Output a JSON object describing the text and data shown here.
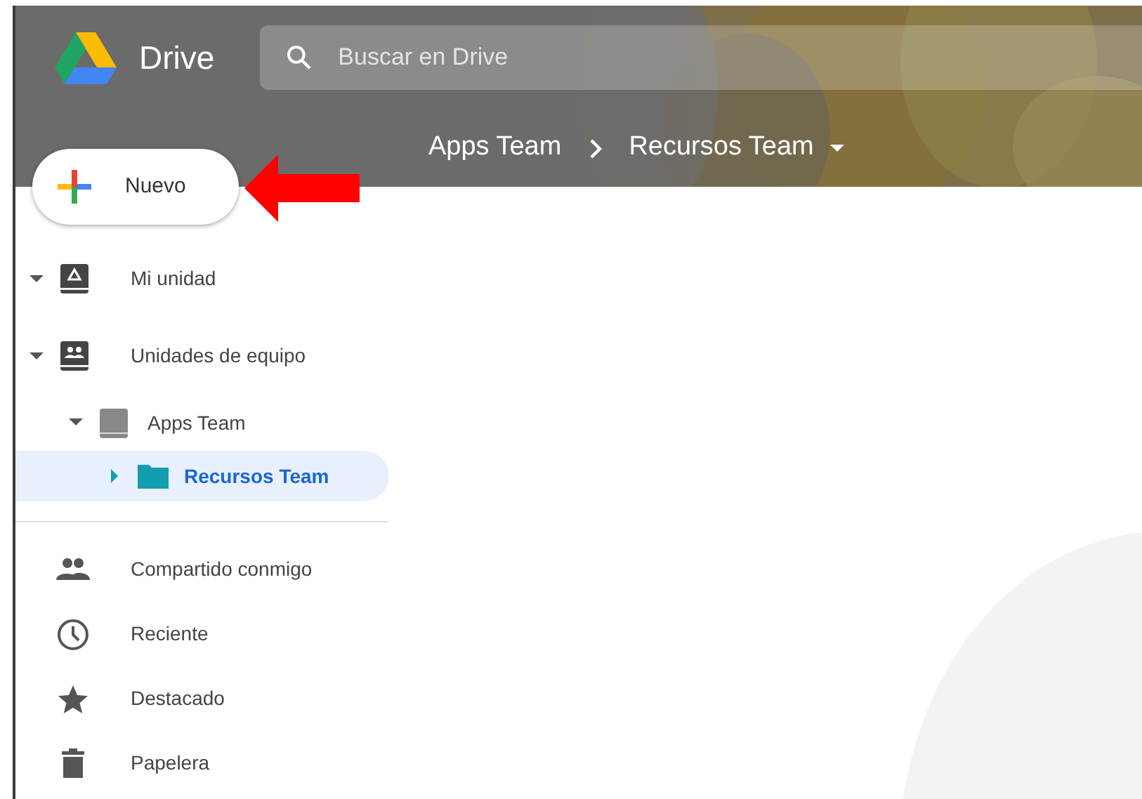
{
  "app": {
    "name": "Drive"
  },
  "search": {
    "placeholder": "Buscar en Drive"
  },
  "breadcrumb": [
    {
      "label": "Apps Team",
      "menu": false
    },
    {
      "label": "Recursos Team",
      "menu": true
    }
  ],
  "new_button": {
    "label": "Nuevo"
  },
  "tree": [
    {
      "label": "Mi unidad",
      "kind": "drive",
      "expanded": true,
      "selected": false
    },
    {
      "label": "Unidades de equipo",
      "kind": "shared-drives",
      "expanded": true,
      "selected": false,
      "children": [
        {
          "label": "Apps Team",
          "kind": "shared-drive",
          "expanded": true,
          "selected": false,
          "children": [
            {
              "label": "Recursos Team",
              "kind": "folder",
              "expanded": false,
              "selected": true
            }
          ]
        }
      ]
    }
  ],
  "nav": [
    {
      "label": "Compartido conmigo",
      "kind": "shared",
      "selected": false
    },
    {
      "label": "Reciente",
      "kind": "recent",
      "selected": false
    },
    {
      "label": "Destacado",
      "kind": "starred",
      "selected": false
    },
    {
      "label": "Papelera",
      "kind": "trash",
      "selected": false
    }
  ]
}
